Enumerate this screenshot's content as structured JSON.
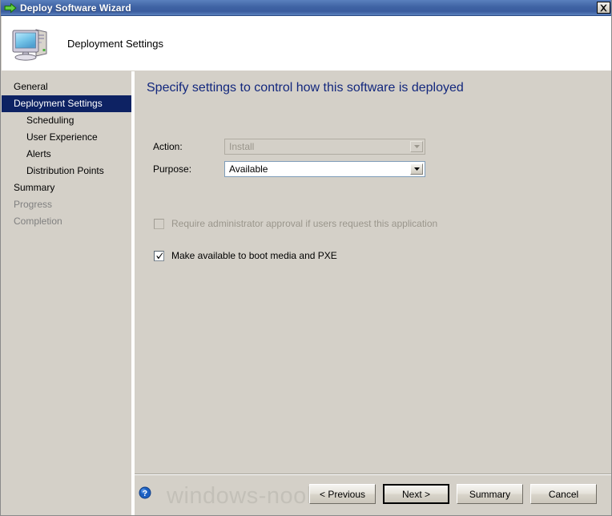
{
  "window": {
    "title": "Deploy Software Wizard",
    "title_icon": "green-arrow-icon",
    "close_label": "close-icon"
  },
  "header": {
    "icon": "computer-icon",
    "title": "Deployment Settings"
  },
  "sidebar": {
    "items": [
      {
        "label": "General",
        "level": 0,
        "state": "normal"
      },
      {
        "label": "Deployment Settings",
        "level": 0,
        "state": "selected"
      },
      {
        "label": "Scheduling",
        "level": 1,
        "state": "normal"
      },
      {
        "label": "User Experience",
        "level": 1,
        "state": "normal"
      },
      {
        "label": "Alerts",
        "level": 1,
        "state": "normal"
      },
      {
        "label": "Distribution Points",
        "level": 1,
        "state": "normal"
      },
      {
        "label": "Summary",
        "level": 0,
        "state": "normal"
      },
      {
        "label": "Progress",
        "level": 0,
        "state": "disabled"
      },
      {
        "label": "Completion",
        "level": 0,
        "state": "disabled"
      }
    ]
  },
  "content": {
    "heading": "Specify settings to control how this software is deployed",
    "fields": [
      {
        "label": "Action:",
        "value": "Install",
        "enabled": false
      },
      {
        "label": "Purpose:",
        "value": "Available",
        "enabled": true
      }
    ],
    "checkboxes": [
      {
        "label": "Require administrator approval if users request this application",
        "checked": false,
        "enabled": false
      },
      {
        "label": "Make available to boot media and PXE",
        "checked": true,
        "enabled": true
      }
    ]
  },
  "footer": {
    "help_icon": "help-icon",
    "watermark": "windows-noob.com",
    "buttons": [
      {
        "label": "< Previous",
        "default": false
      },
      {
        "label": "Next >",
        "default": true
      },
      {
        "label": "Summary",
        "default": false
      },
      {
        "label": "Cancel",
        "default": false
      }
    ]
  },
  "colors": {
    "titlebar_blue": "#3f63a4",
    "face": "#d4d0c8",
    "selection_navy": "#0d2263",
    "heading_blue": "#12277d",
    "disabled_text": "#9a968c",
    "watermark_gray": "#c3c0b8"
  }
}
